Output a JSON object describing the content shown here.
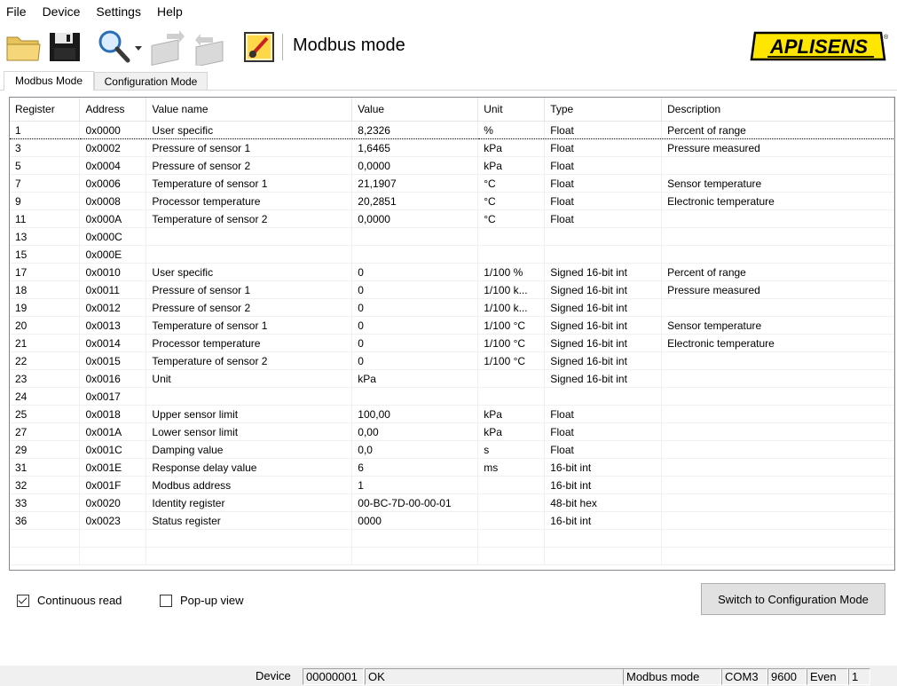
{
  "menu": [
    "File",
    "Device",
    "Settings",
    "Help"
  ],
  "toolbar": {
    "mode_title": "Modbus mode",
    "icons": [
      "open-folder-icon",
      "save-icon",
      "search-icon",
      "dropdown-arrow-icon",
      "device-read-icon",
      "device-write-icon",
      "device-settings-icon"
    ],
    "logo_text": "APLISENS",
    "logo_colors": {
      "background": "#ffe600",
      "text": "#000000"
    }
  },
  "tabs": [
    {
      "label": "Modbus Mode",
      "active": true
    },
    {
      "label": "Configuration Mode",
      "active": false
    }
  ],
  "table": {
    "headers": [
      "Register",
      "Address",
      "Value name",
      "Value",
      "Unit",
      "Type",
      "Description"
    ],
    "rows": [
      [
        "1",
        "0x0000",
        "User specific",
        "8,2326",
        "%",
        "Float",
        "Percent of range"
      ],
      [
        "3",
        "0x0002",
        "Pressure of sensor 1",
        "1,6465",
        "kPa",
        "Float",
        "Pressure measured"
      ],
      [
        "5",
        "0x0004",
        "Pressure of sensor 2",
        "0,0000",
        "kPa",
        "Float",
        ""
      ],
      [
        "7",
        "0x0006",
        "Temperature of sensor 1",
        "21,1907",
        "°C",
        "Float",
        "Sensor temperature"
      ],
      [
        "9",
        "0x0008",
        "Processor temperature",
        "20,2851",
        "°C",
        "Float",
        "Electronic temperature"
      ],
      [
        "11",
        "0x000A",
        "Temperature of sensor 2",
        "0,0000",
        "°C",
        "Float",
        ""
      ],
      [
        "13",
        "0x000C",
        "",
        "",
        "",
        "",
        ""
      ],
      [
        "15",
        "0x000E",
        "",
        "",
        "",
        "",
        ""
      ],
      [
        "17",
        "0x0010",
        "User specific",
        "0",
        "1/100 %",
        "Signed 16-bit int",
        "Percent of range"
      ],
      [
        "18",
        "0x0011",
        "Pressure of sensor 1",
        "0",
        "1/100 k...",
        "Signed 16-bit int",
        "Pressure measured"
      ],
      [
        "19",
        "0x0012",
        "Pressure of sensor 2",
        "0",
        "1/100 k...",
        "Signed 16-bit int",
        ""
      ],
      [
        "20",
        "0x0013",
        "Temperature of sensor 1",
        "0",
        "1/100 °C",
        "Signed 16-bit int",
        "Sensor temperature"
      ],
      [
        "21",
        "0x0014",
        "Processor temperature",
        "0",
        "1/100 °C",
        "Signed 16-bit int",
        "Electronic temperature"
      ],
      [
        "22",
        "0x0015",
        "Temperature of sensor 2",
        "0",
        "1/100 °C",
        "Signed 16-bit int",
        ""
      ],
      [
        "23",
        "0x0016",
        "Unit",
        "kPa",
        "",
        "Signed 16-bit int",
        ""
      ],
      [
        "24",
        "0x0017",
        "",
        "",
        "",
        "",
        ""
      ],
      [
        "25",
        "0x0018",
        "Upper sensor limit",
        "100,00",
        "kPa",
        "Float",
        ""
      ],
      [
        "27",
        "0x001A",
        "Lower sensor limit",
        "0,00",
        "kPa",
        "Float",
        ""
      ],
      [
        "29",
        "0x001C",
        "Damping value",
        "0,0",
        "s",
        "Float",
        ""
      ],
      [
        "31",
        "0x001E",
        "Response delay value",
        "6",
        "ms",
        "16-bit int",
        ""
      ],
      [
        "32",
        "0x001F",
        "Modbus address",
        "1",
        "",
        "16-bit int",
        ""
      ],
      [
        "33",
        "0x0020",
        "Identity register",
        "00-BC-7D-00-00-01",
        "",
        "48-bit hex",
        ""
      ],
      [
        "36",
        "0x0023",
        "Status register",
        "0000",
        "",
        "16-bit int",
        ""
      ],
      [
        "",
        "",
        "",
        "",
        "",
        "",
        ""
      ],
      [
        "",
        "",
        "",
        "",
        "",
        "",
        ""
      ]
    ]
  },
  "options": {
    "continuous_read": {
      "label": "Continuous read",
      "checked": true
    },
    "popup_view": {
      "label": "Pop-up view",
      "checked": false
    }
  },
  "switch_button": "Switch to Configuration Mode",
  "statusbar": {
    "device_label": "Device",
    "device_id": "00000001",
    "device_status": "OK",
    "mode": "Modbus mode",
    "port": "COM3",
    "baud": "9600",
    "parity": "Even",
    "stop_bits": "1"
  }
}
